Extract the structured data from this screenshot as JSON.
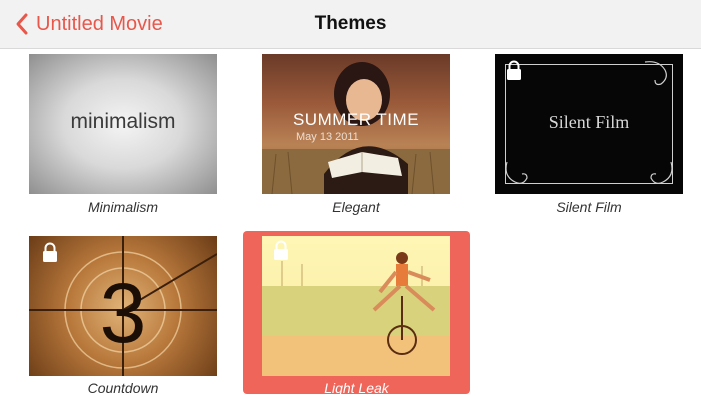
{
  "navbar": {
    "back_label": "Untitled Movie",
    "title": "Themes"
  },
  "themes": [
    {
      "name": "Minimalism",
      "thumb_text": "minimalism",
      "locked": false,
      "selected": false
    },
    {
      "name": "Elegant",
      "thumb_title": "SUMMER TIME",
      "thumb_date": "May 13 2011",
      "locked": false,
      "selected": false
    },
    {
      "name": "Silent Film",
      "thumb_text": "Silent Film",
      "locked": true,
      "selected": false
    },
    {
      "name": "Countdown",
      "thumb_number": "3",
      "locked": true,
      "selected": false
    },
    {
      "name": "Light Leak",
      "locked": true,
      "selected": true
    }
  ],
  "colors": {
    "accent": "#e8574a",
    "selection": "#f0655a",
    "navbar_bg": "#f2f2f2"
  }
}
